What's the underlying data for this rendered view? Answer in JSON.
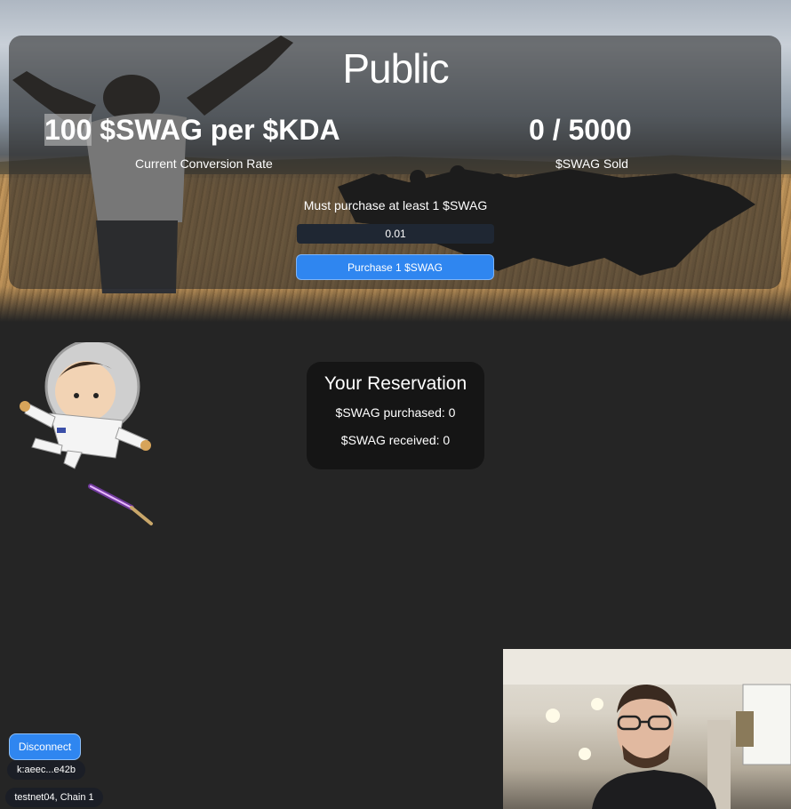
{
  "sale": {
    "title": "Public",
    "rate_number": "100",
    "rate_rest": " $SWAG per $KDA",
    "rate_label": "Current Conversion Rate",
    "sold_value": "0 / 5000",
    "sold_label": "$SWAG Sold",
    "min_purchase_text": "Must purchase at least 1 $SWAG",
    "amount_value": "0.01",
    "purchase_label": "Purchase 1 $SWAG"
  },
  "reservation": {
    "title": "Your Reservation",
    "purchased": "$SWAG purchased: 0",
    "received": "$SWAG received: 0"
  },
  "wallet": {
    "disconnect_label": "Disconnect",
    "account": "k:aeec...e42b",
    "network": "testnet04, Chain 1"
  },
  "colors": {
    "background": "#252525",
    "accent": "#2f86f0",
    "card": "#151515"
  }
}
